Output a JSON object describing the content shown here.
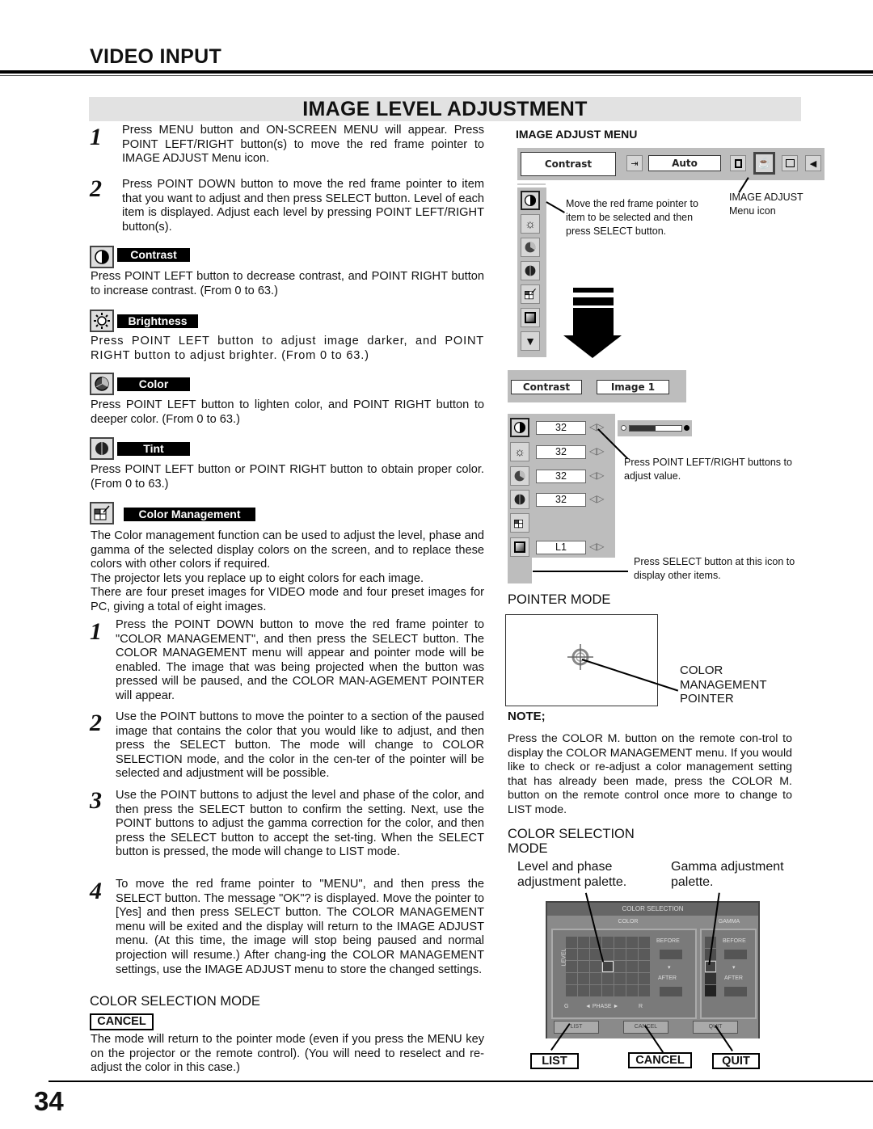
{
  "section_title": "VIDEO INPUT",
  "page_title": "IMAGE LEVEL ADJUSTMENT",
  "page_number": "34",
  "steps_intro": [
    {
      "num": "1",
      "text": "Press MENU button and ON-SCREEN MENU will appear. Press POINT LEFT/RIGHT button(s) to move the red frame pointer to IMAGE ADJUST Menu icon."
    },
    {
      "num": "2",
      "text": "Press POINT DOWN button to move the red frame pointer to item that you want to adjust and then press SELECT button. Level of each item is displayed.  Adjust each level by pressing POINT LEFT/RIGHT button(s)."
    }
  ],
  "items": [
    {
      "icon": "contrast-icon",
      "label": "Contrast",
      "text": "Press POINT LEFT button to decrease contrast, and POINT RIGHT button to increase contrast.  (From 0 to 63.)"
    },
    {
      "icon": "brightness-icon",
      "label": "Brightness",
      "text": "Press POINT LEFT button to adjust image darker, and POINT RIGHT button to adjust brighter.  (From 0 to 63.)"
    },
    {
      "icon": "color-icon",
      "label": "Color",
      "text": "Press POINT LEFT button to lighten color, and POINT RIGHT button to deeper color.  (From 0 to 63.)"
    },
    {
      "icon": "tint-icon",
      "label": "Tint",
      "text": "Press POINT LEFT button or POINT RIGHT button to obtain proper color.  (From 0 to 63.)"
    },
    {
      "icon": "color-management-icon",
      "label": "Color Management",
      "text": "The Color management function can be used to adjust the level, phase and gamma of the selected display colors on the screen, and to replace these colors with other colors if required.",
      "text2": "The projector lets you replace up to eight colors for each image.",
      "text3": "There are four preset images for VIDEO mode and four preset images for PC, giving a total of eight images."
    }
  ],
  "cm_steps": [
    {
      "num": "1",
      "text": "Press the POINT DOWN button to move the red frame pointer to \"COLOR MANAGEMENT\", and then press the SELECT button. The COLOR MANAGEMENT menu will appear and pointer mode will be enabled. The image that was being projected when the button was pressed will be paused, and the COLOR MAN-AGEMENT POINTER will appear."
    },
    {
      "num": "2",
      "text": "Use the POINT buttons to move the pointer to a section of the paused image that contains the color that you would like to adjust, and then press the SELECT button. The mode will change to COLOR SELECTION mode, and the color in the cen-ter of the pointer will be selected and adjustment will be possible."
    },
    {
      "num": "3",
      "text": "Use the POINT buttons to adjust the level and phase of the color, and then press the SELECT button to confirm the setting. Next, use the POINT buttons to adjust the gamma correction for the color, and then press the SELECT button to accept the set-ting. When the SELECT button is pressed, the mode will change to LIST mode."
    },
    {
      "num": "4",
      "text": "To move the red frame pointer to \"MENU\", and then press the SELECT button. The message \"OK\"? is displayed. Move the pointer to [Yes] and then press SELECT button. The COLOR MANAGEMENT menu will be exited and the display will return to the IMAGE ADJUST menu. (At this time, the image will stop being paused and normal projection will resume.) After chang-ing the COLOR MANAGEMENT settings, use the IMAGE ADJUST menu to store the changed settings."
    }
  ],
  "csm_left": {
    "title": "COLOR SELECTION MODE",
    "cancel_label": "CANCEL",
    "text": "The mode will return to the pointer mode (even if you press the MENU key on the projector or the remote control). (You will need to reselect and re-adjust the color in this case.)"
  },
  "image_adjust_menu": {
    "heading": "IMAGE ADJUST MENU",
    "top_bar": {
      "item_label": "Contrast",
      "auto_label": "Auto"
    },
    "callout_pointer": "Move the red frame pointer to item to be selected and then press SELECT button.",
    "callout_icon": "IMAGE ADJUST Menu icon",
    "sub_bar": {
      "item_label": "Contrast",
      "image_label": "Image 1"
    },
    "rows": [
      {
        "icon": "contrast-icon",
        "value": "32"
      },
      {
        "icon": "brightness-icon",
        "value": "32"
      },
      {
        "icon": "color-icon",
        "value": "32"
      },
      {
        "icon": "tint-icon",
        "value": "32"
      },
      {
        "icon": "color-management-icon",
        "value": ""
      },
      {
        "icon": "gamma-icon",
        "value": "L1"
      }
    ],
    "slider_fraction": 0.5,
    "callout_adjust": "Press POINT LEFT/RIGHT buttons to adjust value.",
    "callout_more": "Press SELECT button at this icon to display other items."
  },
  "pointer_mode": {
    "heading": "POINTER MODE",
    "callout": "COLOR MANAGEMENT POINTER"
  },
  "note": {
    "heading": "NOTE;",
    "text": "Press the COLOR M. button on the remote con-trol to display the COLOR MANAGEMENT menu. If you would like to check or re-adjust a color management setting that has already been made, press the COLOR M. button on the remote control once more to change to LIST mode."
  },
  "color_selection": {
    "heading": "COLOR SELECTION MODE",
    "label_level_phase": "Level and phase adjustment palette.",
    "label_gamma": "Gamma adjustment palette.",
    "osd_title": "COLOR SELECTION",
    "osd_color": "COLOR",
    "osd_gamma": "GAMMA",
    "osd_level": "LEVEL",
    "osd_phase": "◄ PHASE ►",
    "osd_g": "G",
    "osd_r": "R",
    "osd_before": "BEFORE",
    "osd_after": "AFTER",
    "osd_list": "LIST",
    "osd_cancel": "CANCEL",
    "osd_quit": "QUIT",
    "btn_list": "LIST",
    "btn_cancel": "CANCEL",
    "btn_quit": "QUIT"
  }
}
